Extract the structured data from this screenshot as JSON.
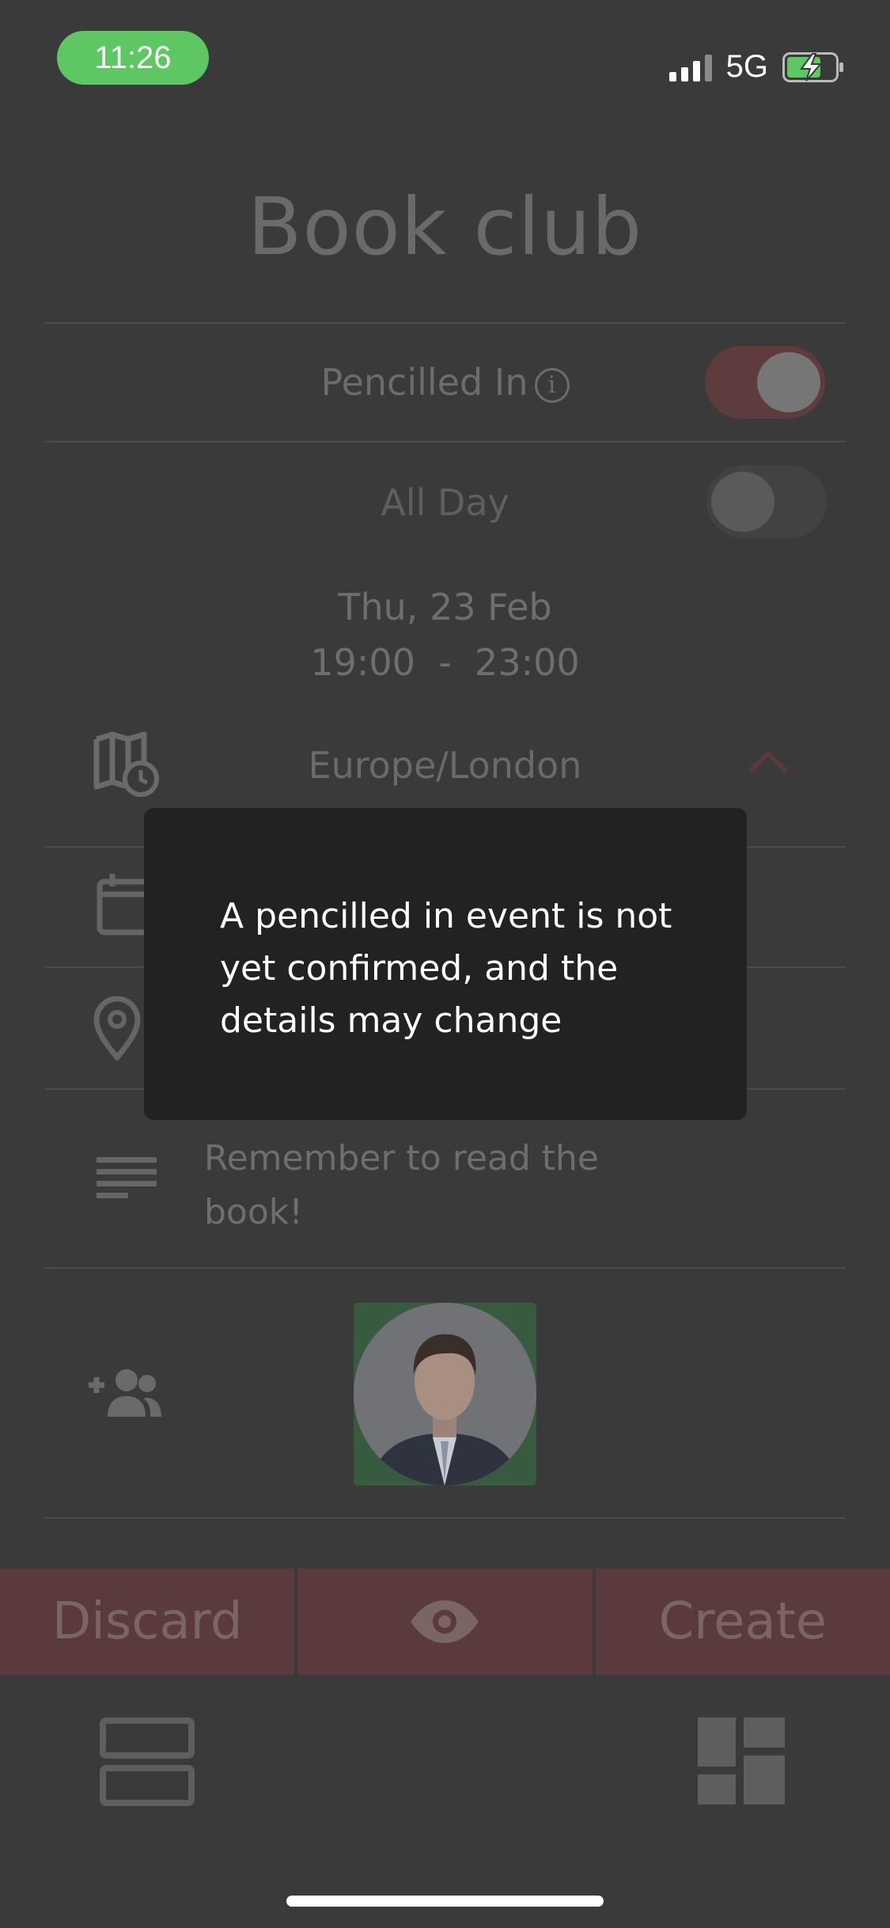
{
  "status_bar": {
    "time": "11:26",
    "network": "5G"
  },
  "event": {
    "title": "Book club",
    "pencilled_in_label": "Pencilled In",
    "pencilled_in_on": true,
    "all_day_label": "All Day",
    "all_day_on": false,
    "date": "Thu, 23 Feb",
    "start_time": "19:00",
    "time_separator": "-",
    "end_time": "23:00",
    "timezone": "Europe/London",
    "notes": "Remember to read the book!"
  },
  "actions": {
    "discard": "Discard",
    "create": "Create"
  },
  "toast": {
    "message": "A pencilled in event is not yet confirmed, and the details may change"
  },
  "colors": {
    "accent": "#5a3a3c",
    "toast_bg": "#222222",
    "time_pill": "#5ec663",
    "avatar_bg": "#385a3e"
  }
}
